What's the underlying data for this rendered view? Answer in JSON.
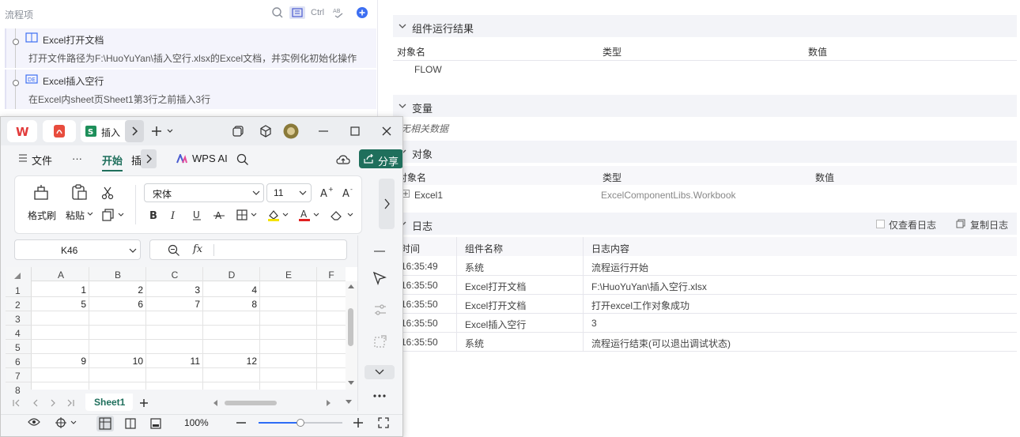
{
  "flow": {
    "title": "流程项",
    "ctrl_label": "Ctrl",
    "steps": [
      {
        "title": "Excel打开文档",
        "desc": "打开文件路径为F:\\HuoYuYan\\插入空行.xlsx的Excel文档，并实例化初始化操作"
      },
      {
        "title": "Excel插入空行",
        "desc": "在Excel内sheet页Sheet1第3行之前插入3行"
      }
    ]
  },
  "result": {
    "component_section": "组件运行结果",
    "component_headers": [
      "对象名",
      "类型",
      "数值"
    ],
    "component_rows": [
      {
        "name": "FLOW",
        "type": "",
        "value": ""
      }
    ],
    "variable_section": "变量",
    "variable_empty": "无相关数据",
    "object_section": "对象",
    "object_headers": [
      "对象名",
      "类型",
      "数值"
    ],
    "object_rows": [
      {
        "name": "Excel1",
        "type": "ExcelComponentLibs.Workbook",
        "value": ""
      }
    ],
    "log_section": "日志",
    "log_only_label": "仅查看日志",
    "log_copy_label": "复制日志",
    "log_headers": [
      "时间",
      "组件名称",
      "日志内容"
    ],
    "log_rows": [
      {
        "time": "16:35:49",
        "component": "系统",
        "content": "流程运行开始"
      },
      {
        "time": "16:35:50",
        "component": "Excel打开文档",
        "content": "F:\\HuoYuYan\\插入空行.xlsx"
      },
      {
        "time": "16:35:50",
        "component": "Excel打开文档",
        "content": "打开excel工作对象成功"
      },
      {
        "time": "16:35:50",
        "component": "Excel插入空行",
        "content": "3"
      },
      {
        "time": "16:35:50",
        "component": "系统",
        "content": "流程运行结束(可以退出调试状态)"
      }
    ]
  },
  "wps": {
    "tab_label": "插入",
    "menu": {
      "file": "文件",
      "more": "···",
      "home": "开始",
      "insert": "插",
      "ai": "WPS AI",
      "share": "分享"
    },
    "ribbon": {
      "format_painter": "格式刷",
      "paste": "粘贴",
      "font": "宋体",
      "font_size": "11"
    },
    "name_box": "K46",
    "fx": "fx",
    "columns": [
      "A",
      "B",
      "C",
      "D",
      "E",
      "F"
    ],
    "rows": [
      "1",
      "2",
      "3",
      "4",
      "5",
      "6",
      "7",
      "8"
    ],
    "cells": {
      "r1": [
        "1",
        "2",
        "3",
        "4"
      ],
      "r2": [
        "5",
        "6",
        "7",
        "8"
      ],
      "r6": [
        "9",
        "10",
        "11",
        "12"
      ]
    },
    "sheet_tab": "Sheet1",
    "zoom": "100%",
    "zoom_level": 0.5
  },
  "colors": {
    "accent": "#1f6f5c",
    "brand_red": "#e23b3b",
    "link_blue": "#2d6cf6"
  }
}
